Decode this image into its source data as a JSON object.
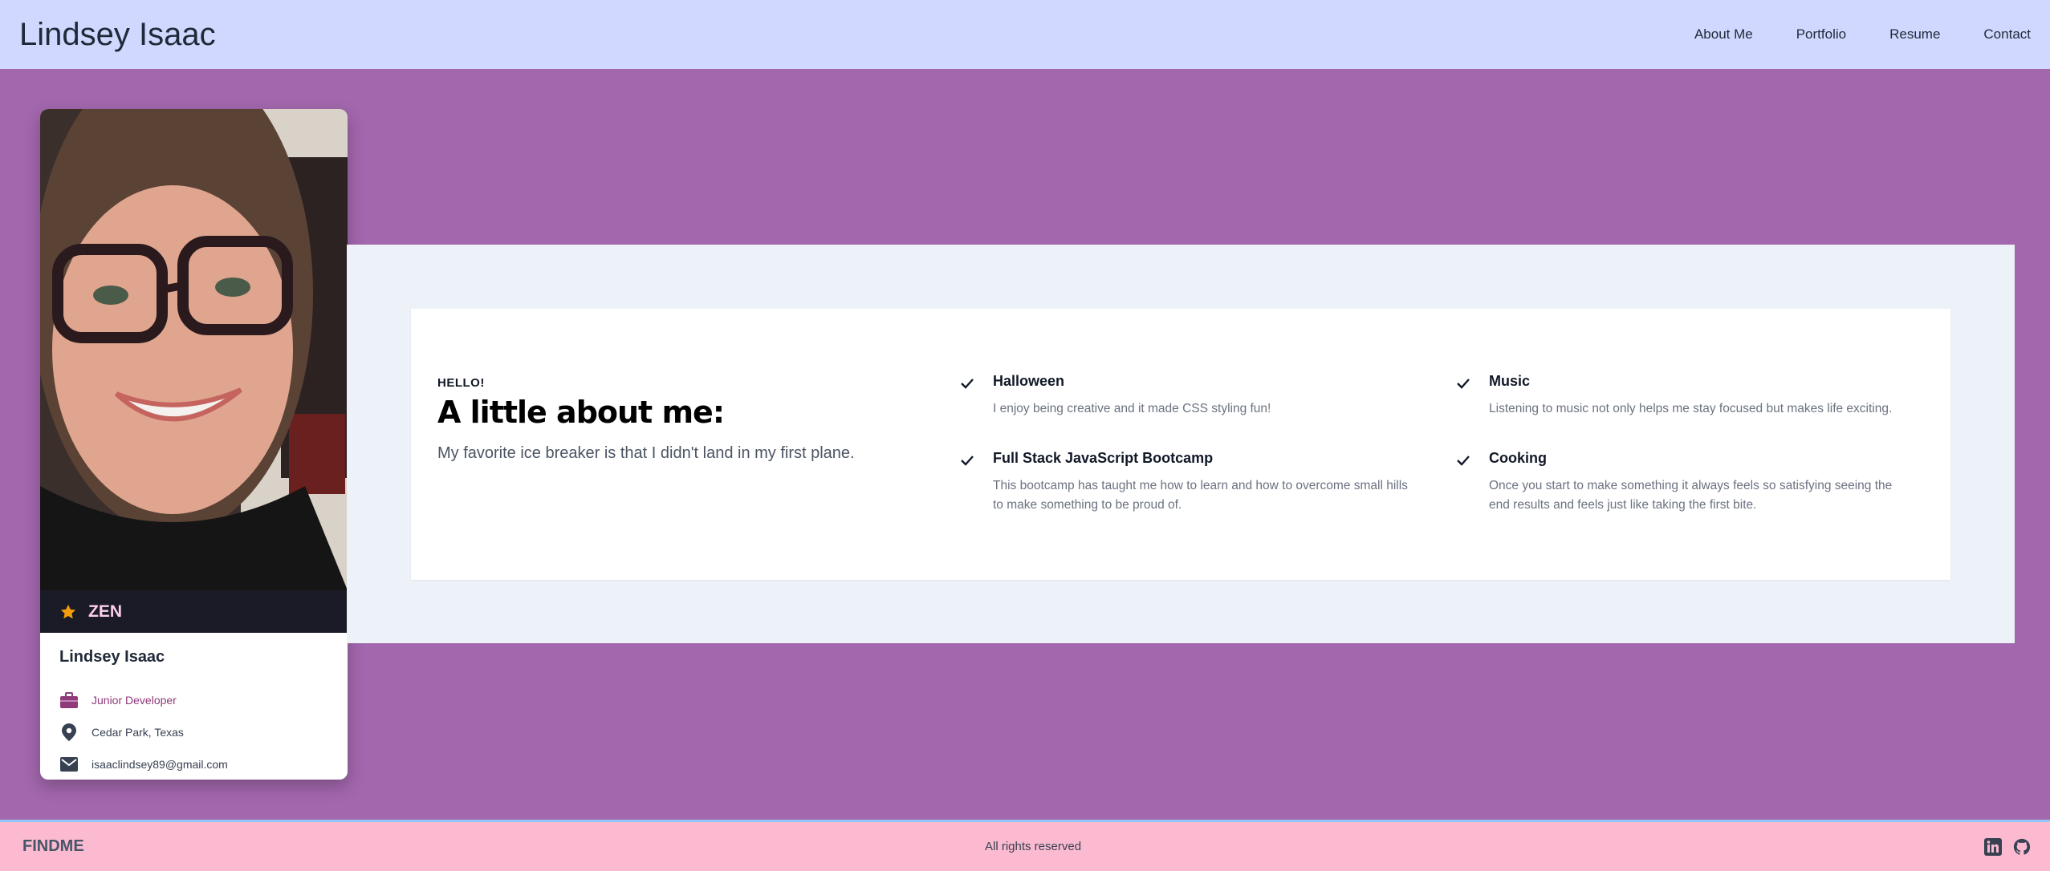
{
  "header": {
    "brand": "Lindsey Isaac",
    "nav": [
      "About Me",
      "Portfolio",
      "Resume",
      "Contact"
    ]
  },
  "profile": {
    "badge": "ZEN",
    "name": "Lindsey Isaac",
    "job": "Junior Developer",
    "location": "Cedar Park, Texas",
    "email": "isaaclindsey89@gmail.com",
    "colors": {
      "accent": "#8f3a7a",
      "badge_bg": "#1a1b26",
      "star": "#f59e0b"
    }
  },
  "about": {
    "hello": "HELLO!",
    "headline": "A little about me:",
    "tagline": "My favorite ice breaker is that I didn't land in my first plane.",
    "features": [
      {
        "title": "Halloween",
        "desc": "I enjoy being creative and it made CSS styling fun!"
      },
      {
        "title": "Music",
        "desc": "Listening to music not only helps me stay focused but makes life exciting."
      },
      {
        "title": "Full Stack JavaScript Bootcamp",
        "desc": "This bootcamp has taught me how to learn and how to overcome small hills to make something to be proud of."
      },
      {
        "title": "Cooking",
        "desc": "Once you start to make something it always feels so satisfying seeing the end results and feels just like taking the first bite."
      }
    ]
  },
  "footer": {
    "brand": "FINDME",
    "text": "All rights reserved",
    "icons": [
      "linkedin-icon",
      "github-icon"
    ]
  }
}
